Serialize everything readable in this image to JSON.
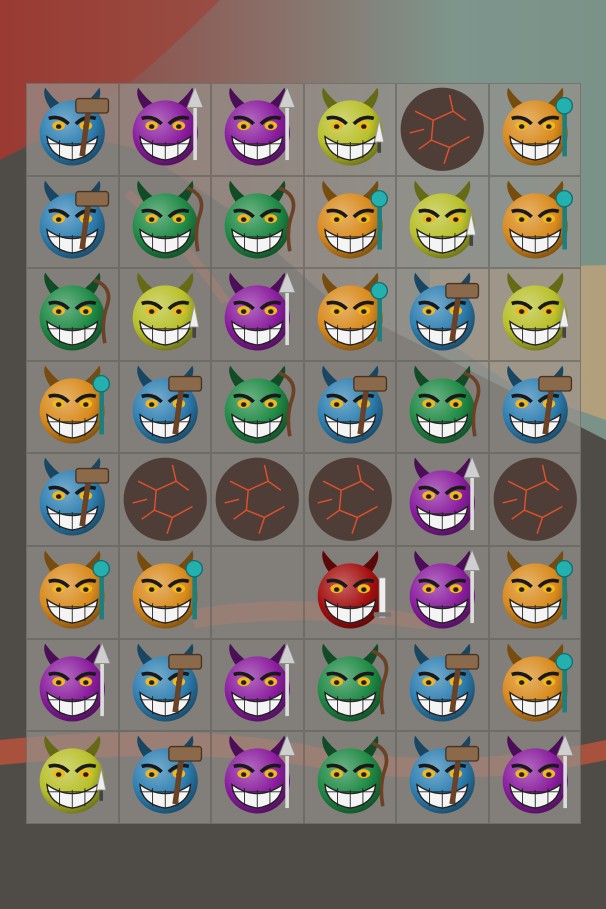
{
  "colors": {
    "blue": "#2d7fb2",
    "purple": "#8a1c9e",
    "green": "#1f8a45",
    "yellow": "#b8c02a",
    "orange": "#d98a1c",
    "red": "#a50f0f",
    "rock": "#4f3e38",
    "rock_crack": "#e0502a"
  },
  "board": {
    "rows": 8,
    "cols": 6,
    "grid": [
      [
        {
          "color": "blue",
          "item": "hammer"
        },
        {
          "color": "purple",
          "item": "spear"
        },
        {
          "color": "purple",
          "item": "spear"
        },
        {
          "color": "yellow",
          "item": "dagger"
        },
        {
          "color": "rock",
          "item": "none"
        },
        {
          "color": "orange",
          "item": "staff"
        }
      ],
      [
        {
          "color": "blue",
          "item": "hammer"
        },
        {
          "color": "green",
          "item": "whip"
        },
        {
          "color": "green",
          "item": "whip"
        },
        {
          "color": "orange",
          "item": "staff"
        },
        {
          "color": "yellow",
          "item": "dagger"
        },
        {
          "color": "orange",
          "item": "staff"
        }
      ],
      [
        {
          "color": "green",
          "item": "whip"
        },
        {
          "color": "yellow",
          "item": "dagger"
        },
        {
          "color": "purple",
          "item": "spear"
        },
        {
          "color": "orange",
          "item": "staff"
        },
        {
          "color": "blue",
          "item": "hammer"
        },
        {
          "color": "yellow",
          "item": "dagger"
        }
      ],
      [
        {
          "color": "orange",
          "item": "staff"
        },
        {
          "color": "blue",
          "item": "hammer"
        },
        {
          "color": "green",
          "item": "whip"
        },
        {
          "color": "blue",
          "item": "hammer"
        },
        {
          "color": "green",
          "item": "whip"
        },
        {
          "color": "blue",
          "item": "hammer"
        }
      ],
      [
        {
          "color": "blue",
          "item": "hammer"
        },
        {
          "color": "rock",
          "item": "none"
        },
        {
          "color": "rock",
          "item": "none"
        },
        {
          "color": "rock",
          "item": "none"
        },
        {
          "color": "purple",
          "item": "spear"
        },
        {
          "color": "rock",
          "item": "none"
        }
      ],
      [
        {
          "color": "orange",
          "item": "staff"
        },
        {
          "color": "orange",
          "item": "staff"
        },
        {
          "color": "empty",
          "item": "none"
        },
        {
          "color": "red",
          "item": "sword"
        },
        {
          "color": "purple",
          "item": "spear"
        },
        {
          "color": "orange",
          "item": "staff"
        }
      ],
      [
        {
          "color": "purple",
          "item": "spear"
        },
        {
          "color": "blue",
          "item": "hammer"
        },
        {
          "color": "purple",
          "item": "spear"
        },
        {
          "color": "green",
          "item": "whip"
        },
        {
          "color": "blue",
          "item": "hammer"
        },
        {
          "color": "orange",
          "item": "staff"
        }
      ],
      [
        {
          "color": "yellow",
          "item": "dagger"
        },
        {
          "color": "blue",
          "item": "hammer"
        },
        {
          "color": "purple",
          "item": "spear"
        },
        {
          "color": "green",
          "item": "whip"
        },
        {
          "color": "blue",
          "item": "hammer"
        },
        {
          "color": "purple",
          "item": "spear"
        }
      ]
    ]
  }
}
